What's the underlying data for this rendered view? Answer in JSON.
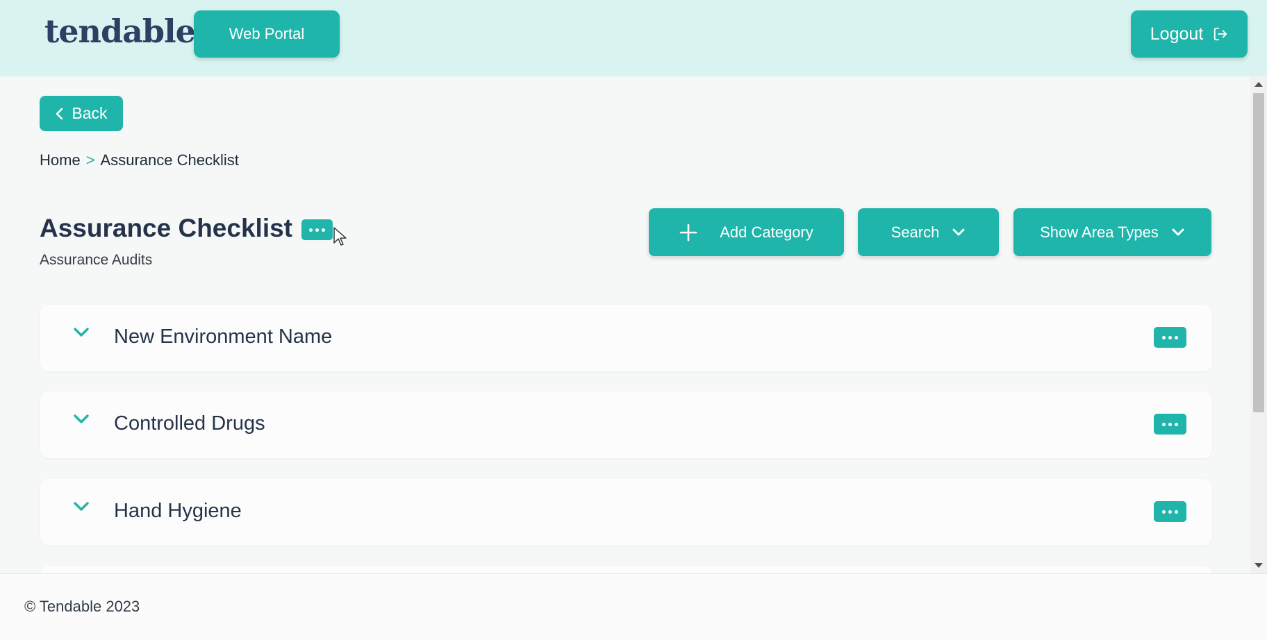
{
  "header": {
    "logo_text": "tendable",
    "web_portal_label": "Web Portal",
    "logout_label": "Logout"
  },
  "nav": {
    "back_label": "Back",
    "breadcrumb": {
      "home": "Home",
      "separator": ">",
      "current": "Assurance Checklist"
    }
  },
  "page": {
    "title": "Assurance Checklist",
    "subtitle": "Assurance Audits"
  },
  "toolbar": {
    "add_category_label": "Add Category",
    "search_label": "Search",
    "show_area_types_label": "Show Area Types"
  },
  "categories": [
    {
      "name": "New Environment Name"
    },
    {
      "name": "Controlled Drugs"
    },
    {
      "name": "Hand Hygiene"
    }
  ],
  "footer": {
    "copyright": "© Tendable 2023"
  },
  "colors": {
    "accent": "#1fb5aa",
    "header_bg": "#d8f3f0",
    "text_dark": "#25334a"
  }
}
